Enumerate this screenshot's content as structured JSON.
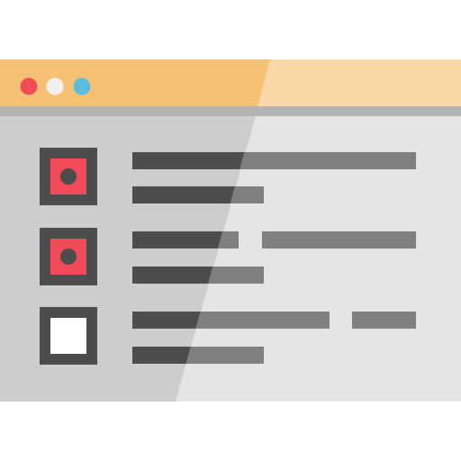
{
  "window": {
    "title_bar_color": "#F7C173",
    "title_bar_highlight_color": "#FBD7A8",
    "divider_color": "#B4B4B4",
    "body_color": "#CDCDCD",
    "body_highlight_color": "#E5E5E5",
    "controls": [
      {
        "name": "close-dot",
        "color": "#F04B57"
      },
      {
        "name": "minimize-dot",
        "color": "#F0F0F0"
      },
      {
        "name": "maximize-dot",
        "color": "#5BBCE0"
      }
    ]
  },
  "checklist": {
    "box_border_color": "#4D4D4D",
    "checked_fill_color": "#F04B57",
    "unchecked_fill_color": "#FFFFFF",
    "dot_color": "#4D4D4D",
    "text_line_color_dark": "#4D4D4D",
    "text_line_color_light": "#808080",
    "items": [
      {
        "state": "checked",
        "checked": true
      },
      {
        "state": "checked",
        "checked": true
      },
      {
        "state": "unchecked",
        "checked": false
      }
    ]
  }
}
